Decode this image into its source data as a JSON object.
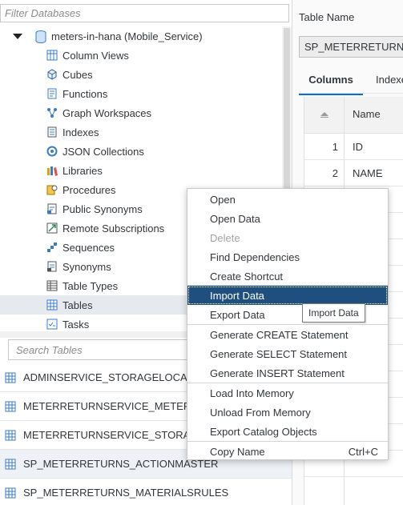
{
  "left_panel": {
    "filter_placeholder": "Filter Databases",
    "tree": {
      "root_label": "meters-in-hana (Mobile_Service)",
      "items": [
        {
          "label": "Column Views",
          "icon": "column-views-icon"
        },
        {
          "label": "Cubes",
          "icon": "cube-icon"
        },
        {
          "label": "Functions",
          "icon": "function-icon"
        },
        {
          "label": "Graph Workspaces",
          "icon": "graph-icon"
        },
        {
          "label": "Indexes",
          "icon": "index-icon"
        },
        {
          "label": "JSON Collections",
          "icon": "json-icon"
        },
        {
          "label": "Libraries",
          "icon": "library-icon"
        },
        {
          "label": "Procedures",
          "icon": "procedure-icon"
        },
        {
          "label": "Public Synonyms",
          "icon": "public-synonym-icon"
        },
        {
          "label": "Remote Subscriptions",
          "icon": "remote-subscription-icon"
        },
        {
          "label": "Sequences",
          "icon": "sequence-icon"
        },
        {
          "label": "Synonyms",
          "icon": "synonym-icon"
        },
        {
          "label": "Table Types",
          "icon": "table-type-icon"
        },
        {
          "label": "Tables",
          "icon": "table-icon"
        },
        {
          "label": "Tasks",
          "icon": "task-icon"
        }
      ]
    },
    "search_placeholder": "Search Tables",
    "tables": [
      "ADMINSERVICE_STORAGELOCA",
      "METERRETURNSERVICE_METER",
      "METERRETURNSERVICE_STORA",
      "SP_METERRETURNS_ACTIONMASTER",
      "SP_METERRETURNS_MATERIALSRULES"
    ]
  },
  "right_panel": {
    "table_name_label": "Table Name",
    "table_name_value": "SP_METERRETURNS_ACTIONMASTER",
    "tabs": [
      {
        "label": "Columns"
      },
      {
        "label": "Indexes"
      }
    ],
    "grid": {
      "header_name": "Name",
      "rows": [
        {
          "num": "1",
          "name": "ID"
        },
        {
          "num": "2",
          "name": "NAME"
        }
      ]
    }
  },
  "context_menu": {
    "items": [
      {
        "label": "Open"
      },
      {
        "label": "Open Data"
      },
      {
        "label": "Delete"
      },
      {
        "label": "Find Dependencies"
      },
      {
        "label": "Create Shortcut"
      },
      {
        "label": "Import Data"
      },
      {
        "label": "Export Data"
      },
      {
        "label": "Generate CREATE Statement"
      },
      {
        "label": "Generate SELECT Statement"
      },
      {
        "label": "Generate INSERT Statement"
      },
      {
        "label": "Load Into Memory"
      },
      {
        "label": "Unload From Memory"
      },
      {
        "label": "Export Catalog Objects"
      },
      {
        "label": "Copy Name",
        "shortcut": "Ctrl+C"
      }
    ],
    "tooltip": "Import Data"
  },
  "colors": {
    "highlight": "#1f4f7f",
    "tab_accent": "#0a6ed1",
    "selected_row": "#e6eaef"
  }
}
